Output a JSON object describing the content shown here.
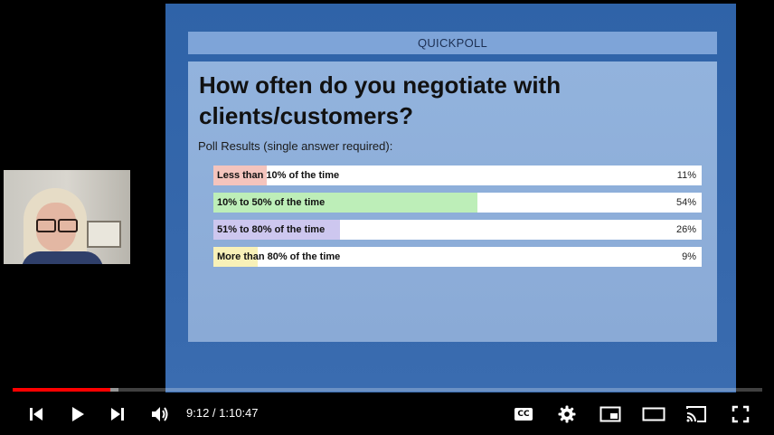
{
  "slide": {
    "header": "QUICKPOLL",
    "question": "How often do you negotiate with clients/customers?",
    "subtitle": "Poll Results (single answer required):",
    "options": [
      {
        "label": "Less than 10% of the time",
        "percent_text": "11%",
        "fraction": 0.11,
        "color": "#f4c4bd"
      },
      {
        "label": "10% to 50% of the time",
        "percent_text": "54%",
        "fraction": 0.54,
        "color": "#bdeeb8"
      },
      {
        "label": "51% to 80% of the time",
        "percent_text": "26%",
        "fraction": 0.26,
        "color": "#cdc7ef"
      },
      {
        "label": "More than 80% of the time",
        "percent_text": "9%",
        "fraction": 0.09,
        "color": "#f8f1b8"
      }
    ]
  },
  "player": {
    "time_display": "9:12 / 1:10:47",
    "progress_fraction": 0.13,
    "buffered_fraction": 0.141,
    "accent_color": "#ff0000",
    "cc_label": "CC",
    "icons": [
      "previous-icon",
      "play-icon",
      "next-icon",
      "volume-icon",
      "captions-icon",
      "settings-icon",
      "miniplayer-icon",
      "theater-mode-icon",
      "cast-icon",
      "fullscreen-icon"
    ]
  }
}
